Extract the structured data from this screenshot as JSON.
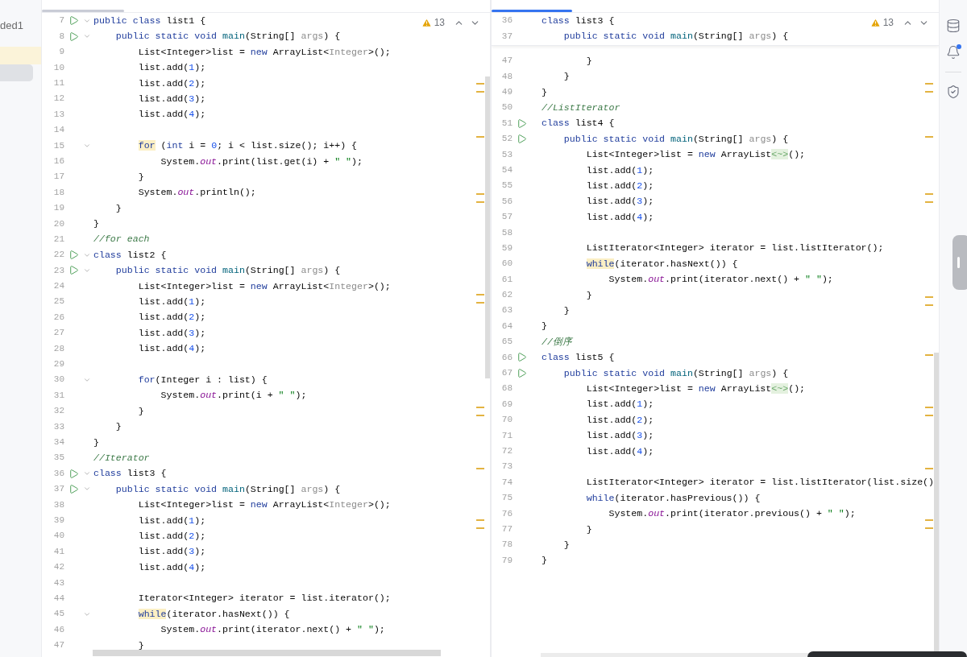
{
  "sidebar": {
    "text": "ded1"
  },
  "panes": [
    {
      "focused": false,
      "warnings": "13",
      "lines": [
        {
          "number": "7",
          "run": true,
          "fold": true,
          "tokens": [
            {
              "kind": "keyword",
              "text": "public class "
            },
            {
              "kind": "plain",
              "text": "list1 {"
            }
          ]
        },
        {
          "number": "8",
          "run": true,
          "fold": true,
          "tokens": [
            {
              "kind": "keyword",
              "text": "    public static void "
            },
            {
              "kind": "method",
              "text": "main"
            },
            {
              "kind": "plain",
              "text": "(String[] "
            },
            {
              "kind": "param",
              "text": "args"
            },
            {
              "kind": "plain",
              "text": ") {"
            }
          ]
        },
        {
          "number": "9",
          "run": false,
          "fold": false,
          "tokens": [
            {
              "kind": "plain",
              "text": "        List<Integer>list = "
            },
            {
              "kind": "keyword",
              "text": "new"
            },
            {
              "kind": "plain",
              "text": " ArrayList<"
            },
            {
              "kind": "param",
              "text": "Integer"
            },
            {
              "kind": "plain",
              "text": ">();"
            }
          ]
        },
        {
          "number": "10",
          "run": false,
          "fold": false,
          "tokens": [
            {
              "kind": "plain",
              "text": "        list.add("
            },
            {
              "kind": "number",
              "text": "1"
            },
            {
              "kind": "plain",
              "text": ");"
            }
          ]
        },
        {
          "number": "11",
          "run": false,
          "fold": false,
          "tokens": [
            {
              "kind": "plain",
              "text": "        list.add("
            },
            {
              "kind": "number",
              "text": "2"
            },
            {
              "kind": "plain",
              "text": ");"
            }
          ]
        },
        {
          "number": "12",
          "run": false,
          "fold": false,
          "tokens": [
            {
              "kind": "plain",
              "text": "        list.add("
            },
            {
              "kind": "number",
              "text": "3"
            },
            {
              "kind": "plain",
              "text": ");"
            }
          ]
        },
        {
          "number": "13",
          "run": false,
          "fold": false,
          "tokens": [
            {
              "kind": "plain",
              "text": "        list.add("
            },
            {
              "kind": "number",
              "text": "4"
            },
            {
              "kind": "plain",
              "text": ");"
            }
          ]
        },
        {
          "number": "14",
          "run": false,
          "fold": false
        },
        {
          "number": "15",
          "run": false,
          "fold": true,
          "tokens": [
            {
              "kind": "keyword_hl",
              "text": "        for"
            },
            {
              "kind": "plain",
              "text": " ("
            },
            {
              "kind": "keyword",
              "text": "int"
            },
            {
              "kind": "plain",
              "text": " i = "
            },
            {
              "kind": "number",
              "text": "0"
            },
            {
              "kind": "plain",
              "text": "; i < list.size(); i++) {"
            }
          ]
        },
        {
          "number": "16",
          "run": false,
          "fold": false,
          "tokens": [
            {
              "kind": "plain",
              "text": "            System."
            },
            {
              "kind": "field",
              "text": "out"
            },
            {
              "kind": "plain",
              "text": ".print(list.get(i) + "
            },
            {
              "kind": "string",
              "text": "\" \""
            },
            {
              "kind": "plain",
              "text": ");"
            }
          ]
        },
        {
          "number": "17",
          "run": false,
          "fold": false,
          "tokens": [
            {
              "kind": "plain",
              "text": "        }"
            }
          ]
        },
        {
          "number": "18",
          "run": false,
          "fold": false,
          "tokens": [
            {
              "kind": "plain",
              "text": "        System."
            },
            {
              "kind": "field",
              "text": "out"
            },
            {
              "kind": "plain",
              "text": ".println();"
            }
          ]
        },
        {
          "number": "19",
          "run": false,
          "fold": false,
          "tokens": [
            {
              "kind": "plain",
              "text": "    }"
            }
          ]
        },
        {
          "number": "20",
          "run": false,
          "fold": false,
          "tokens": [
            {
              "kind": "plain",
              "text": "}"
            }
          ]
        },
        {
          "number": "21",
          "run": false,
          "fold": false,
          "tokens": [
            {
              "kind": "comment",
              "text": "//for each"
            }
          ]
        },
        {
          "number": "22",
          "run": true,
          "fold": true,
          "tokens": [
            {
              "kind": "keyword",
              "text": "class "
            },
            {
              "kind": "plain",
              "text": "list2 {"
            }
          ]
        },
        {
          "number": "23",
          "run": true,
          "fold": true,
          "tokens": [
            {
              "kind": "keyword",
              "text": "    public static void "
            },
            {
              "kind": "method",
              "text": "main"
            },
            {
              "kind": "plain",
              "text": "(String[] "
            },
            {
              "kind": "param",
              "text": "args"
            },
            {
              "kind": "plain",
              "text": ") {"
            }
          ]
        },
        {
          "number": "24",
          "run": false,
          "fold": false,
          "tokens": [
            {
              "kind": "plain",
              "text": "        List<Integer>list = "
            },
            {
              "kind": "keyword",
              "text": "new"
            },
            {
              "kind": "plain",
              "text": " ArrayList<"
            },
            {
              "kind": "param",
              "text": "Integer"
            },
            {
              "kind": "plain",
              "text": ">();"
            }
          ]
        },
        {
          "number": "25",
          "run": false,
          "fold": false,
          "tokens": [
            {
              "kind": "plain",
              "text": "        list.add("
            },
            {
              "kind": "number",
              "text": "1"
            },
            {
              "kind": "plain",
              "text": ");"
            }
          ]
        },
        {
          "number": "26",
          "run": false,
          "fold": false,
          "tokens": [
            {
              "kind": "plain",
              "text": "        list.add("
            },
            {
              "kind": "number",
              "text": "2"
            },
            {
              "kind": "plain",
              "text": ");"
            }
          ]
        },
        {
          "number": "27",
          "run": false,
          "fold": false,
          "tokens": [
            {
              "kind": "plain",
              "text": "        list.add("
            },
            {
              "kind": "number",
              "text": "3"
            },
            {
              "kind": "plain",
              "text": ");"
            }
          ]
        },
        {
          "number": "28",
          "run": false,
          "fold": false,
          "tokens": [
            {
              "kind": "plain",
              "text": "        list.add("
            },
            {
              "kind": "number",
              "text": "4"
            },
            {
              "kind": "plain",
              "text": ");"
            }
          ]
        },
        {
          "number": "29",
          "run": false,
          "fold": false
        },
        {
          "number": "30",
          "run": false,
          "fold": true,
          "tokens": [
            {
              "kind": "keyword",
              "text": "        for"
            },
            {
              "kind": "plain",
              "text": "(Integer i : list) {"
            }
          ]
        },
        {
          "number": "31",
          "run": false,
          "fold": false,
          "tokens": [
            {
              "kind": "plain",
              "text": "            System."
            },
            {
              "kind": "field",
              "text": "out"
            },
            {
              "kind": "plain",
              "text": ".print(i + "
            },
            {
              "kind": "string",
              "text": "\" \""
            },
            {
              "kind": "plain",
              "text": ");"
            }
          ]
        },
        {
          "number": "32",
          "run": false,
          "fold": false,
          "tokens": [
            {
              "kind": "plain",
              "text": "        }"
            }
          ]
        },
        {
          "number": "33",
          "run": false,
          "fold": false,
          "tokens": [
            {
              "kind": "plain",
              "text": "    }"
            }
          ]
        },
        {
          "number": "34",
          "run": false,
          "fold": false,
          "tokens": [
            {
              "kind": "plain",
              "text": "}"
            }
          ]
        },
        {
          "number": "35",
          "run": false,
          "fold": false,
          "tokens": [
            {
              "kind": "comment",
              "text": "//Iterator"
            }
          ]
        },
        {
          "number": "36",
          "run": true,
          "fold": true,
          "tokens": [
            {
              "kind": "keyword",
              "text": "class "
            },
            {
              "kind": "plain",
              "text": "list3 {"
            }
          ]
        },
        {
          "number": "37",
          "run": true,
          "fold": true,
          "tokens": [
            {
              "kind": "keyword",
              "text": "    public static void "
            },
            {
              "kind": "method",
              "text": "main"
            },
            {
              "kind": "plain",
              "text": "(String[] "
            },
            {
              "kind": "param",
              "text": "args"
            },
            {
              "kind": "plain",
              "text": ") {"
            }
          ]
        },
        {
          "number": "38",
          "run": false,
          "fold": false,
          "tokens": [
            {
              "kind": "plain",
              "text": "        List<Integer>list = "
            },
            {
              "kind": "keyword",
              "text": "new"
            },
            {
              "kind": "plain",
              "text": " ArrayList<"
            },
            {
              "kind": "param",
              "text": "Integer"
            },
            {
              "kind": "plain",
              "text": ">();"
            }
          ]
        },
        {
          "number": "39",
          "run": false,
          "fold": false,
          "tokens": [
            {
              "kind": "plain",
              "text": "        list.add("
            },
            {
              "kind": "number",
              "text": "1"
            },
            {
              "kind": "plain",
              "text": ");"
            }
          ]
        },
        {
          "number": "40",
          "run": false,
          "fold": false,
          "tokens": [
            {
              "kind": "plain",
              "text": "        list.add("
            },
            {
              "kind": "number",
              "text": "2"
            },
            {
              "kind": "plain",
              "text": ");"
            }
          ]
        },
        {
          "number": "41",
          "run": false,
          "fold": false,
          "tokens": [
            {
              "kind": "plain",
              "text": "        list.add("
            },
            {
              "kind": "number",
              "text": "3"
            },
            {
              "kind": "plain",
              "text": ");"
            }
          ]
        },
        {
          "number": "42",
          "run": false,
          "fold": false,
          "tokens": [
            {
              "kind": "plain",
              "text": "        list.add("
            },
            {
              "kind": "number",
              "text": "4"
            },
            {
              "kind": "plain",
              "text": ");"
            }
          ]
        },
        {
          "number": "43",
          "run": false,
          "fold": false
        },
        {
          "number": "44",
          "run": false,
          "fold": false,
          "tokens": [
            {
              "kind": "plain",
              "text": "        Iterator<Integer> iterator = list.iterator();"
            }
          ]
        },
        {
          "number": "45",
          "run": false,
          "fold": true,
          "tokens": [
            {
              "kind": "keyword_hl",
              "text": "        while"
            },
            {
              "kind": "plain",
              "text": "(iterator.hasNext()) {"
            }
          ]
        },
        {
          "number": "46",
          "run": false,
          "fold": false,
          "tokens": [
            {
              "kind": "plain",
              "text": "            System."
            },
            {
              "kind": "field",
              "text": "out"
            },
            {
              "kind": "plain",
              "text": ".print(iterator.next() + "
            },
            {
              "kind": "string",
              "text": "\" \""
            },
            {
              "kind": "plain",
              "text": ");"
            }
          ]
        },
        {
          "number": "47",
          "run": false,
          "fold": false,
          "tokens": [
            {
              "kind": "plain",
              "text": "        }"
            }
          ]
        }
      ]
    },
    {
      "focused": true,
      "warnings": "13",
      "sticky_lines": [
        {
          "number": "36",
          "run": false,
          "fold": false,
          "tokens": [
            {
              "kind": "keyword",
              "text": "class "
            },
            {
              "kind": "plain",
              "text": "list3 {"
            }
          ]
        },
        {
          "number": "37",
          "run": false,
          "fold": false,
          "tokens": [
            {
              "kind": "keyword",
              "text": "    public static void "
            },
            {
              "kind": "method",
              "text": "main"
            },
            {
              "kind": "plain",
              "text": "(String[] "
            },
            {
              "kind": "param",
              "text": "args"
            },
            {
              "kind": "plain",
              "text": ") {"
            }
          ]
        }
      ],
      "lines": [
        {
          "number": "47",
          "run": false,
          "fold": false,
          "tokens": [
            {
              "kind": "plain",
              "text": "        }"
            }
          ]
        },
        {
          "number": "48",
          "run": false,
          "fold": false,
          "tokens": [
            {
              "kind": "plain",
              "text": "    }"
            }
          ]
        },
        {
          "number": "49",
          "run": false,
          "fold": false,
          "tokens": [
            {
              "kind": "plain",
              "text": "}"
            }
          ]
        },
        {
          "number": "50",
          "run": false,
          "fold": false,
          "tokens": [
            {
              "kind": "comment",
              "text": "//ListIterator"
            }
          ]
        },
        {
          "number": "51",
          "run": true,
          "fold": false,
          "tokens": [
            {
              "kind": "keyword",
              "text": "class "
            },
            {
              "kind": "plain",
              "text": "list4 {"
            }
          ]
        },
        {
          "number": "52",
          "run": true,
          "fold": false,
          "tokens": [
            {
              "kind": "keyword",
              "text": "    public static void "
            },
            {
              "kind": "method",
              "text": "main"
            },
            {
              "kind": "plain",
              "text": "(String[] "
            },
            {
              "kind": "param",
              "text": "args"
            },
            {
              "kind": "plain",
              "text": ") {"
            }
          ]
        },
        {
          "number": "53",
          "run": false,
          "fold": false,
          "tokens": [
            {
              "kind": "plain",
              "text": "        List<Integer>list = "
            },
            {
              "kind": "keyword",
              "text": "new"
            },
            {
              "kind": "plain",
              "text": " ArrayList"
            },
            {
              "kind": "diamond",
              "text": "<~>"
            },
            {
              "kind": "plain",
              "text": "();"
            }
          ]
        },
        {
          "number": "54",
          "run": false,
          "fold": false,
          "tokens": [
            {
              "kind": "plain",
              "text": "        list.add("
            },
            {
              "kind": "number",
              "text": "1"
            },
            {
              "kind": "plain",
              "text": ");"
            }
          ]
        },
        {
          "number": "55",
          "run": false,
          "fold": false,
          "tokens": [
            {
              "kind": "plain",
              "text": "        list.add("
            },
            {
              "kind": "number",
              "text": "2"
            },
            {
              "kind": "plain",
              "text": ");"
            }
          ]
        },
        {
          "number": "56",
          "run": false,
          "fold": false,
          "tokens": [
            {
              "kind": "plain",
              "text": "        list.add("
            },
            {
              "kind": "number",
              "text": "3"
            },
            {
              "kind": "plain",
              "text": ");"
            }
          ]
        },
        {
          "number": "57",
          "run": false,
          "fold": false,
          "tokens": [
            {
              "kind": "plain",
              "text": "        list.add("
            },
            {
              "kind": "number",
              "text": "4"
            },
            {
              "kind": "plain",
              "text": ");"
            }
          ]
        },
        {
          "number": "58",
          "run": false,
          "fold": false
        },
        {
          "number": "59",
          "run": false,
          "fold": false,
          "tokens": [
            {
              "kind": "plain",
              "text": "        ListIterator<Integer> iterator = list.listIterator();"
            }
          ]
        },
        {
          "number": "60",
          "run": false,
          "fold": false,
          "tokens": [
            {
              "kind": "keyword_hl",
              "text": "        while"
            },
            {
              "kind": "plain",
              "text": "(iterator.hasNext()) {"
            }
          ]
        },
        {
          "number": "61",
          "run": false,
          "fold": false,
          "tokens": [
            {
              "kind": "plain",
              "text": "            System."
            },
            {
              "kind": "field",
              "text": "out"
            },
            {
              "kind": "plain",
              "text": ".print(iterator.next() + "
            },
            {
              "kind": "string",
              "text": "\" \""
            },
            {
              "kind": "plain",
              "text": ");"
            }
          ]
        },
        {
          "number": "62",
          "run": false,
          "fold": false,
          "tokens": [
            {
              "kind": "plain",
              "text": "        }"
            }
          ]
        },
        {
          "number": "63",
          "run": false,
          "fold": false,
          "tokens": [
            {
              "kind": "plain",
              "text": "    }"
            }
          ]
        },
        {
          "number": "64",
          "run": false,
          "fold": false,
          "tokens": [
            {
              "kind": "plain",
              "text": "}"
            }
          ]
        },
        {
          "number": "65",
          "run": false,
          "fold": false,
          "tokens": [
            {
              "kind": "comment",
              "text": "//倒序"
            }
          ]
        },
        {
          "number": "66",
          "run": true,
          "fold": false,
          "tokens": [
            {
              "kind": "keyword",
              "text": "class "
            },
            {
              "kind": "plain",
              "text": "list5 {"
            }
          ]
        },
        {
          "number": "67",
          "run": true,
          "fold": false,
          "tokens": [
            {
              "kind": "keyword",
              "text": "    public static void "
            },
            {
              "kind": "method",
              "text": "main"
            },
            {
              "kind": "plain",
              "text": "(String[] "
            },
            {
              "kind": "param",
              "text": "args"
            },
            {
              "kind": "plain",
              "text": ") {"
            }
          ]
        },
        {
          "number": "68",
          "run": false,
          "fold": false,
          "tokens": [
            {
              "kind": "plain",
              "text": "        List<Integer>list = "
            },
            {
              "kind": "keyword",
              "text": "new"
            },
            {
              "kind": "plain",
              "text": " ArrayList"
            },
            {
              "kind": "diamond",
              "text": "<~>"
            },
            {
              "kind": "plain",
              "text": "();"
            }
          ]
        },
        {
          "number": "69",
          "run": false,
          "fold": false,
          "tokens": [
            {
              "kind": "plain",
              "text": "        list.add("
            },
            {
              "kind": "number",
              "text": "1"
            },
            {
              "kind": "plain",
              "text": ");"
            }
          ]
        },
        {
          "number": "70",
          "run": false,
          "fold": false,
          "tokens": [
            {
              "kind": "plain",
              "text": "        list.add("
            },
            {
              "kind": "number",
              "text": "2"
            },
            {
              "kind": "plain",
              "text": ");"
            }
          ]
        },
        {
          "number": "71",
          "run": false,
          "fold": false,
          "tokens": [
            {
              "kind": "plain",
              "text": "        list.add("
            },
            {
              "kind": "number",
              "text": "3"
            },
            {
              "kind": "plain",
              "text": ");"
            }
          ]
        },
        {
          "number": "72",
          "run": false,
          "fold": false,
          "tokens": [
            {
              "kind": "plain",
              "text": "        list.add("
            },
            {
              "kind": "number",
              "text": "4"
            },
            {
              "kind": "plain",
              "text": ");"
            }
          ]
        },
        {
          "number": "73",
          "run": false,
          "fold": false
        },
        {
          "number": "74",
          "run": false,
          "fold": false,
          "tokens": [
            {
              "kind": "plain",
              "text": "        ListIterator<Integer> iterator = list.listIterator(list.size()"
            }
          ]
        },
        {
          "number": "75",
          "run": false,
          "fold": false,
          "tokens": [
            {
              "kind": "keyword",
              "text": "        while"
            },
            {
              "kind": "plain",
              "text": "(iterator.hasPrevious()) {"
            }
          ]
        },
        {
          "number": "76",
          "run": false,
          "fold": false,
          "tokens": [
            {
              "kind": "plain",
              "text": "            System."
            },
            {
              "kind": "field",
              "text": "out"
            },
            {
              "kind": "plain",
              "text": ".print(iterator.previous() + "
            },
            {
              "kind": "string",
              "text": "\" \""
            },
            {
              "kind": "plain",
              "text": ");"
            }
          ]
        },
        {
          "number": "77",
          "run": false,
          "fold": false,
          "tokens": [
            {
              "kind": "plain",
              "text": "        }"
            }
          ]
        },
        {
          "number": "78",
          "run": false,
          "fold": false,
          "tokens": [
            {
              "kind": "plain",
              "text": "    }"
            }
          ]
        },
        {
          "number": "79",
          "run": false,
          "fold": false,
          "tokens": [
            {
              "kind": "plain",
              "text": "}"
            }
          ]
        }
      ]
    }
  ]
}
